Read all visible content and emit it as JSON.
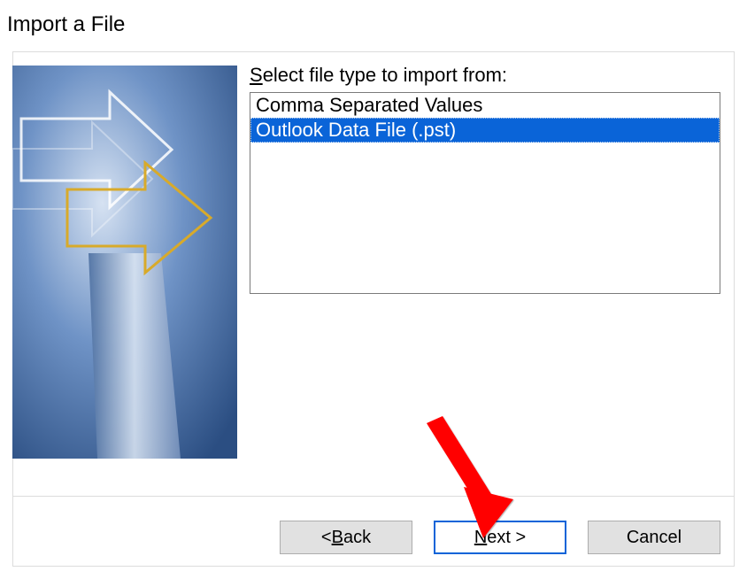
{
  "dialog_title": "Import a File",
  "prompt": {
    "prefix_underlined": "S",
    "rest": "elect file type to import from:"
  },
  "file_types": [
    {
      "label": "Comma Separated Values",
      "selected": false
    },
    {
      "label": "Outlook Data File (.pst)",
      "selected": true
    }
  ],
  "buttons": {
    "back": {
      "prefix": "< ",
      "underlined": "B",
      "rest": "ack"
    },
    "next": {
      "underlined": "N",
      "rest": "ext >"
    },
    "cancel": {
      "label": "Cancel"
    }
  }
}
